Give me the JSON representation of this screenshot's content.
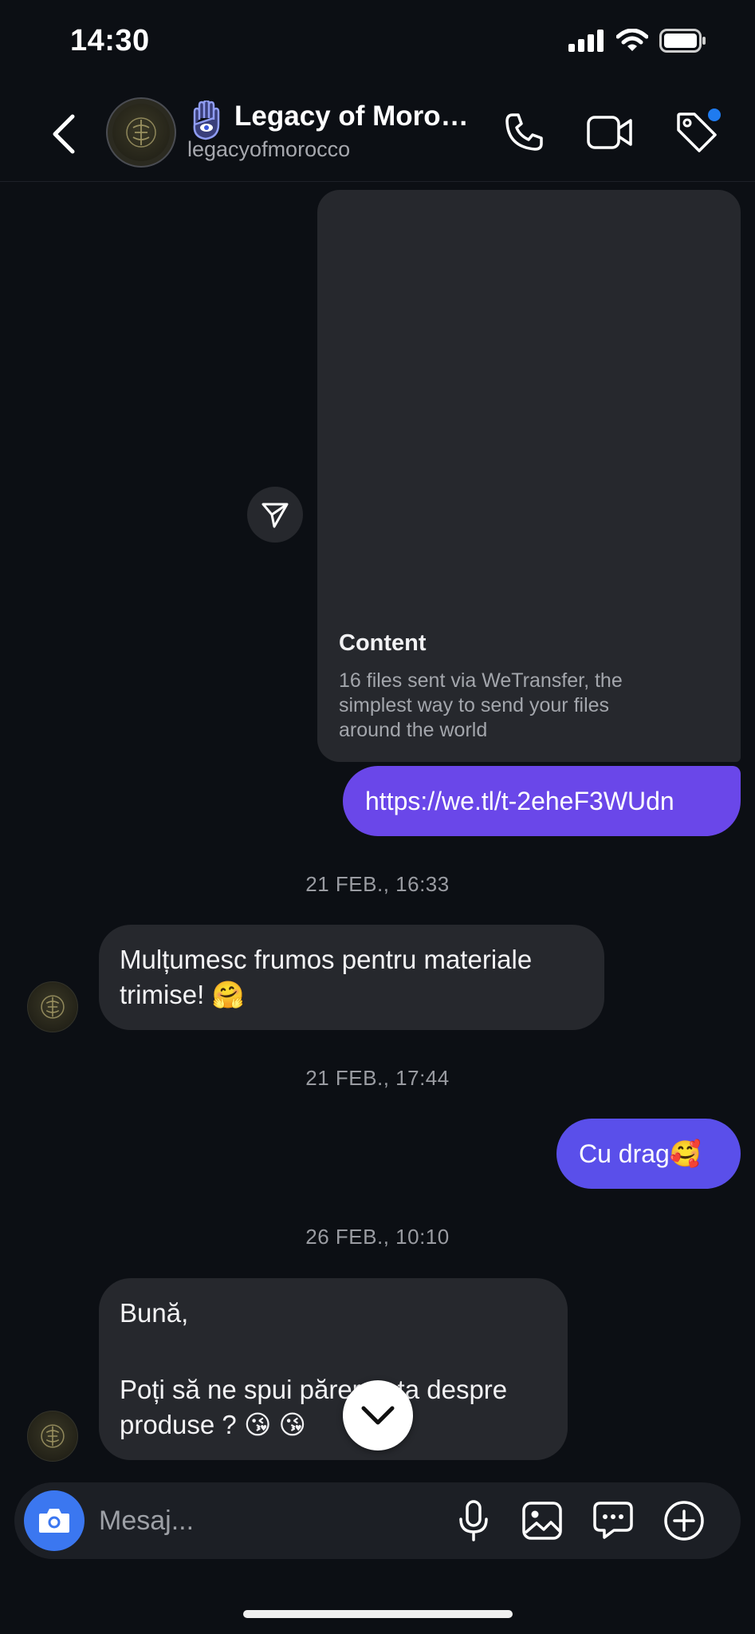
{
  "status": {
    "time": "14:30"
  },
  "header": {
    "name": "Legacy of Moro…",
    "username": "legacyofmorocco"
  },
  "messages": {
    "share_card": {
      "title": "Content",
      "description": "16 files sent via WeTransfer, the simplest way to send your files around the world"
    },
    "link": "https://we.tl/t-2eheF3WUdn",
    "timestamp_1": "21 FEB., 16:33",
    "incoming_1": [
      "Mulțumesc frumos pentru materiale",
      "trimise! 🤗"
    ],
    "timestamp_2": "21 FEB., 17:44",
    "outgoing_2": "Cu drag🥰",
    "timestamp_3": "26 FEB., 10:10",
    "incoming_3": [
      "Bună,",
      "Poți să ne spui părerea ta despre",
      "produse ? 😘 😘"
    ]
  },
  "composer": {
    "placeholder": "Mesaj..."
  },
  "colors": {
    "background": "#0c0f14",
    "bubble_incoming": "#26282d",
    "bubble_outgoing_link": "#6a47e9",
    "bubble_outgoing": "#5a4fea",
    "camera_button": "#3b77f0",
    "notification_dot": "#1f7bef"
  },
  "icons": {
    "status": [
      "signal-icon",
      "wifi-icon",
      "battery-icon"
    ],
    "header": [
      "back-icon",
      "phone-icon",
      "video-call-icon",
      "tag-icon"
    ],
    "composer": [
      "camera-icon",
      "microphone-icon",
      "gallery-icon",
      "chat-bubble-icon",
      "plus-circle-icon"
    ]
  }
}
